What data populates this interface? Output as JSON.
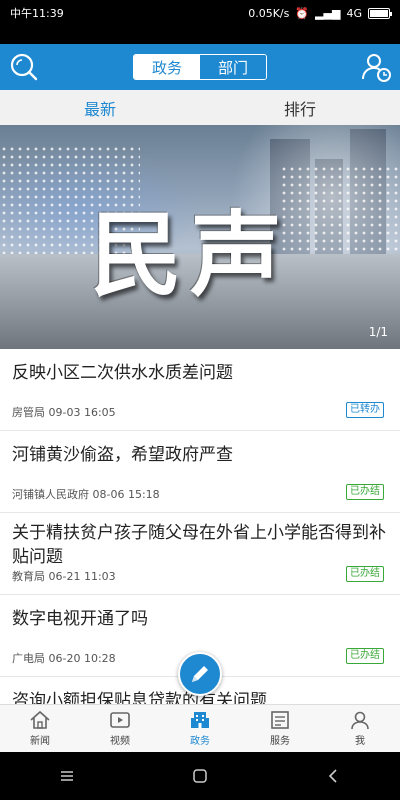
{
  "status_bar": {
    "time": "中午11:39",
    "speed": "0.05K/s",
    "network": "4G"
  },
  "header": {
    "segments": [
      {
        "label": "政务",
        "active": true
      },
      {
        "label": "部门",
        "active": false
      }
    ]
  },
  "tabs": [
    {
      "label": "最新",
      "active": true
    },
    {
      "label": "排行",
      "active": false
    }
  ],
  "banner": {
    "text": "民声",
    "counter": "1/1"
  },
  "news": [
    {
      "title": "反映小区二次供水水质差问题",
      "source": "房管局",
      "date": "09-03 16:05",
      "badge": "已转办",
      "badge_color": "#1e88d0"
    },
    {
      "title": "河铺黄沙偷盗，希望政府严查",
      "source": "河铺镇人民政府",
      "date": "08-06 15:18",
      "badge": "已办结",
      "badge_color": "#3aa838"
    },
    {
      "title": "关于精扶贫户孩子随父母在外省上小学能否得到补贴问题",
      "source": "教育局",
      "date": "06-21 11:03",
      "badge": "已办结",
      "badge_color": "#3aa838"
    },
    {
      "title": "数字电视开通了吗",
      "source": "广电局",
      "date": "06-20 10:28",
      "badge": "已办结",
      "badge_color": "#3aa838"
    },
    {
      "title": "咨询小额担保贴息贷款的有关问题"
    }
  ],
  "bottom_nav": [
    {
      "label": "新闻",
      "icon": "home-icon"
    },
    {
      "label": "视频",
      "icon": "video-icon"
    },
    {
      "label": "政务",
      "icon": "building-icon",
      "active": true
    },
    {
      "label": "服务",
      "icon": "service-icon"
    },
    {
      "label": "我",
      "icon": "person-icon"
    }
  ],
  "colors": {
    "primary": "#1e88d0",
    "done_green": "#3aa838"
  }
}
